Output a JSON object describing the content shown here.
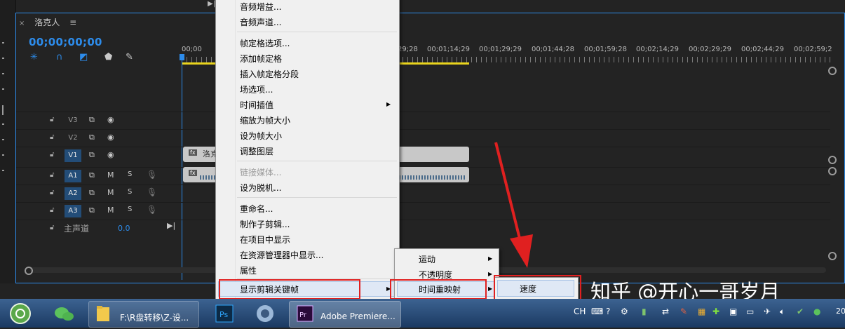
{
  "timeline": {
    "tab_close": "×",
    "tab_title": "洛克人",
    "tab_menu": "≡",
    "timecode": "00;00;00;00",
    "ruler": [
      "00;00",
      "29;28",
      "00;01;14;29",
      "00;01;29;29",
      "00;01;44;28",
      "00;01;59;28",
      "00;02;14;29",
      "00;02;29;29",
      "00;02;44;29",
      "00;02;59;2"
    ],
    "tracks": [
      {
        "name": "V3",
        "type": "video",
        "on": false
      },
      {
        "name": "V2",
        "type": "video",
        "on": false
      },
      {
        "name": "V1",
        "type": "video",
        "on": true
      },
      {
        "name": "A1",
        "type": "audio",
        "on": true
      },
      {
        "name": "A2",
        "type": "audio",
        "on": true
      },
      {
        "name": "A3",
        "type": "audio",
        "on": true
      }
    ],
    "mute_label": "M",
    "solo_label": "S",
    "master_label": "主声道",
    "master_value": "0.0",
    "clip_v_name": "洛克",
    "clip_fx": "fx"
  },
  "context_menu": {
    "items": [
      {
        "label": "音频增益...",
        "disabled": false
      },
      {
        "label": "音频声道...",
        "disabled": false
      },
      {
        "label": "帧定格选项...",
        "disabled": false
      },
      {
        "label": "添加帧定格",
        "disabled": false
      },
      {
        "label": "插入帧定格分段",
        "disabled": false
      },
      {
        "label": "场选项...",
        "disabled": false
      },
      {
        "label": "时间插值",
        "disabled": false
      },
      {
        "label": "缩放为帧大小",
        "disabled": false
      },
      {
        "label": "设为帧大小",
        "disabled": false
      },
      {
        "label": "调整图层",
        "disabled": false
      },
      {
        "label": "链接媒体...",
        "disabled": true
      },
      {
        "label": "设为脱机...",
        "disabled": false
      },
      {
        "label": "重命名...",
        "disabled": false
      },
      {
        "label": "制作子剪辑...",
        "disabled": false
      },
      {
        "label": "在项目中显示",
        "disabled": false
      },
      {
        "label": "在资源管理器中显示...",
        "disabled": false
      },
      {
        "label": "属性",
        "disabled": false
      },
      {
        "label": "显示剪辑关键帧",
        "disabled": false
      }
    ],
    "submenu": [
      "运动",
      "不透明度",
      "时间重映射"
    ],
    "submenu2": [
      "速度"
    ]
  },
  "taskbar": {
    "explorer_label": "F:\\R盘转移\\Z-设...",
    "premiere_label": "Adobe Premiere...",
    "lang": "CH",
    "clock_partial": "20"
  },
  "watermark": "知乎 @开心一哥岁月",
  "colors": {
    "accent": "#2d8ceb",
    "annotation": "#e02020",
    "workarea": "#e9d41d"
  }
}
